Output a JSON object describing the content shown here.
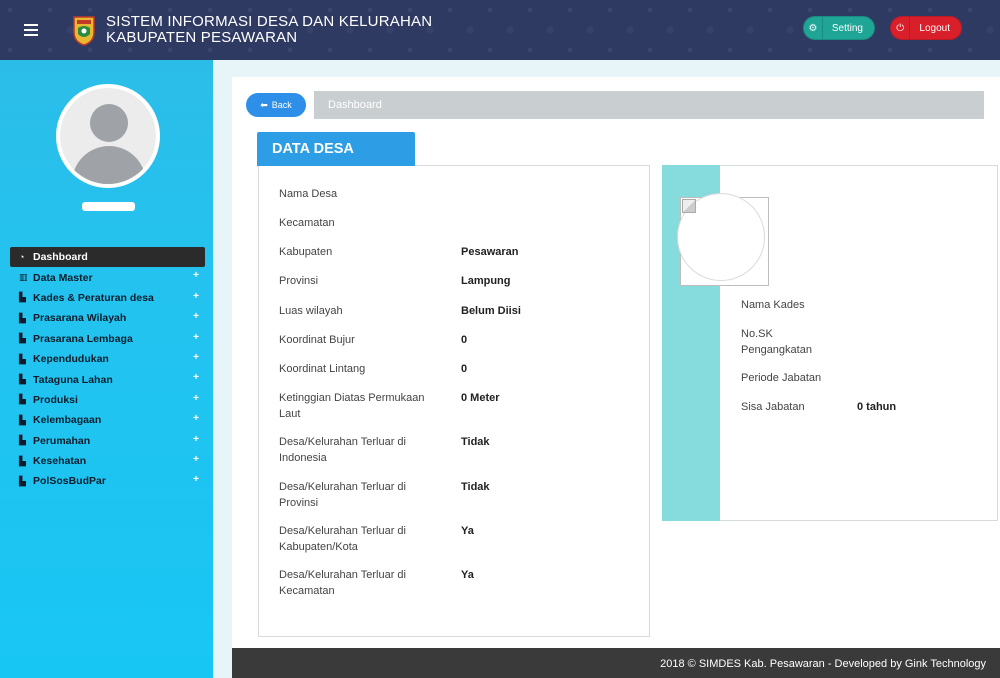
{
  "header": {
    "title_line1": "SISTEM INFORMASI DESA DAN KELURAHAN",
    "title_line2": "KABUPATEN PESAWARAN",
    "setting_label": "Setting",
    "logout_label": "Logout",
    "icons": {
      "menu": "hamburger-icon",
      "setting": "gear-icon",
      "logout": "power-icon",
      "logo": "pesawaran-crest-logo"
    },
    "colors": {
      "bar": "#2f3a63",
      "setting": "#1fa596",
      "logout": "#d9202a"
    }
  },
  "sidebar": {
    "items": [
      {
        "label": "Dashboard",
        "icon": "dashboard-icon",
        "active": true,
        "expandable": false
      },
      {
        "label": "Data Master",
        "icon": "bank-icon",
        "active": false,
        "expandable": true
      },
      {
        "label": "Kades & Peraturan desa",
        "icon": "document-icon",
        "active": false,
        "expandable": true
      },
      {
        "label": "Prasarana Wilayah",
        "icon": "document-icon",
        "active": false,
        "expandable": true
      },
      {
        "label": "Prasarana Lembaga",
        "icon": "document-icon",
        "active": false,
        "expandable": true
      },
      {
        "label": "Kependudukan",
        "icon": "document-icon",
        "active": false,
        "expandable": true
      },
      {
        "label": "Tataguna Lahan",
        "icon": "document-icon",
        "active": false,
        "expandable": true
      },
      {
        "label": "Produksi",
        "icon": "document-icon",
        "active": false,
        "expandable": true
      },
      {
        "label": "Kelembagaan",
        "icon": "document-icon",
        "active": false,
        "expandable": true
      },
      {
        "label": "Perumahan",
        "icon": "document-icon",
        "active": false,
        "expandable": true
      },
      {
        "label": "Kesehatan",
        "icon": "document-icon",
        "active": false,
        "expandable": true
      },
      {
        "label": "PolSosBudPar",
        "icon": "document-icon",
        "active": false,
        "expandable": true
      }
    ],
    "plus_symbol": "+"
  },
  "toolbar": {
    "back_label": "Back",
    "breadcrumb": "Dashboard"
  },
  "data_desa": {
    "title": "DATA DESA",
    "rows": [
      {
        "label": "Nama Desa",
        "value": ""
      },
      {
        "label": "Kecamatan",
        "value": ""
      },
      {
        "label": "Kabupaten",
        "value": "Pesawaran"
      },
      {
        "label": "Provinsi",
        "value": "Lampung"
      },
      {
        "label": "Luas wilayah",
        "value": "Belum Diisi"
      },
      {
        "label": "Koordinat Bujur",
        "value": "0"
      },
      {
        "label": "Koordinat Lintang",
        "value": "0"
      },
      {
        "label": "Ketinggian Diatas Permukaan Laut",
        "value": "0 Meter"
      },
      {
        "label": "Desa/Kelurahan Terluar di Indonesia",
        "value": "Tidak"
      },
      {
        "label": "Desa/Kelurahan Terluar di Provinsi",
        "value": "Tidak"
      },
      {
        "label": "Desa/Kelurahan Terluar di Kabupaten/Kota",
        "value": "Ya"
      },
      {
        "label": "Desa/Kelurahan Terluar di Kecamatan",
        "value": "Ya"
      }
    ]
  },
  "kades": {
    "rows": [
      {
        "label": "Nama Kades",
        "value": ""
      },
      {
        "label": "No.SK Pengangkatan",
        "value": ""
      },
      {
        "label": "Periode Jabatan",
        "value": ""
      },
      {
        "label": "Sisa Jabatan",
        "value": "0 tahun"
      }
    ]
  },
  "footer": {
    "text": "2018 © SIMDES Kab. Pesawaran - Developed by Gink Technology"
  }
}
